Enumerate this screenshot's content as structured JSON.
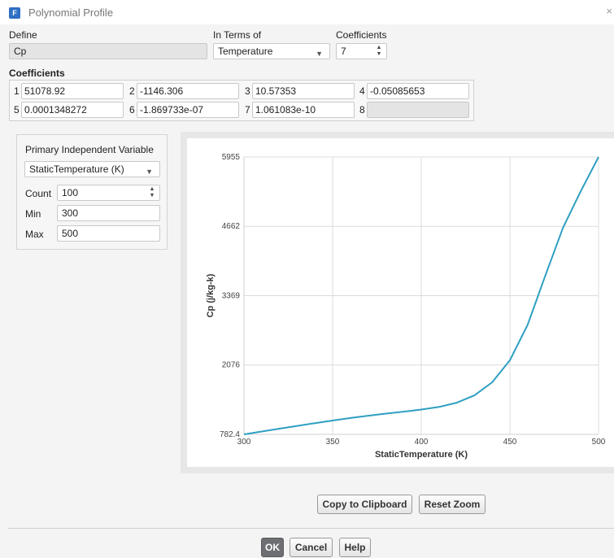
{
  "window": {
    "title": "Polynomial Profile",
    "app_icon_letter": "F",
    "close_glyph": "×"
  },
  "define": {
    "label": "Define",
    "value": "Cp"
  },
  "in_terms_of": {
    "label": "In Terms of",
    "value": "Temperature"
  },
  "coefficients_count": {
    "label": "Coefficients",
    "value": "7"
  },
  "coefficients": {
    "heading": "Coefficients",
    "items": [
      {
        "index": "1",
        "value": "51078.92"
      },
      {
        "index": "2",
        "value": "-1146.306"
      },
      {
        "index": "3",
        "value": "10.57353"
      },
      {
        "index": "4",
        "value": "-0.05085653"
      },
      {
        "index": "5",
        "value": "0.0001348272"
      },
      {
        "index": "6",
        "value": "-1.869733e-07"
      },
      {
        "index": "7",
        "value": "1.061083e-10"
      },
      {
        "index": "8",
        "value": ""
      }
    ]
  },
  "variable_panel": {
    "heading": "Primary Independent Variable",
    "variable": "StaticTemperature (K)",
    "count_label": "Count",
    "count_value": "100",
    "min_label": "Min",
    "min_value": "300",
    "max_label": "Max",
    "max_value": "500"
  },
  "chart_data": {
    "type": "line",
    "xlabel": "StaticTemperature (K)",
    "ylabel": "Cp (j/kg-k)",
    "xlim": [
      300,
      500
    ],
    "ylim": [
      782.4,
      5955
    ],
    "x_ticks": [
      "300",
      "350",
      "400",
      "450",
      "500"
    ],
    "y_ticks": [
      "782.4",
      "2076",
      "3369",
      "4662",
      "5955"
    ],
    "grid": true,
    "series": [
      {
        "color": "#2e9fc2",
        "x": [
          300,
          310,
          320,
          330,
          340,
          350,
          360,
          370,
          380,
          390,
          400,
          410,
          420,
          430,
          440,
          450,
          460,
          470,
          480,
          490,
          500
        ],
        "y": [
          782,
          835,
          888,
          940,
          992,
          1041,
          1087,
          1130,
          1169,
          1206,
          1245,
          1294,
          1372,
          1509,
          1753,
          2164,
          2826,
          3745,
          4640,
          5320,
          5955
        ]
      }
    ]
  },
  "buttons": {
    "copy": "Copy to Clipboard",
    "reset_zoom": "Reset Zoom",
    "ok": "OK",
    "cancel": "Cancel",
    "help": "Help"
  }
}
